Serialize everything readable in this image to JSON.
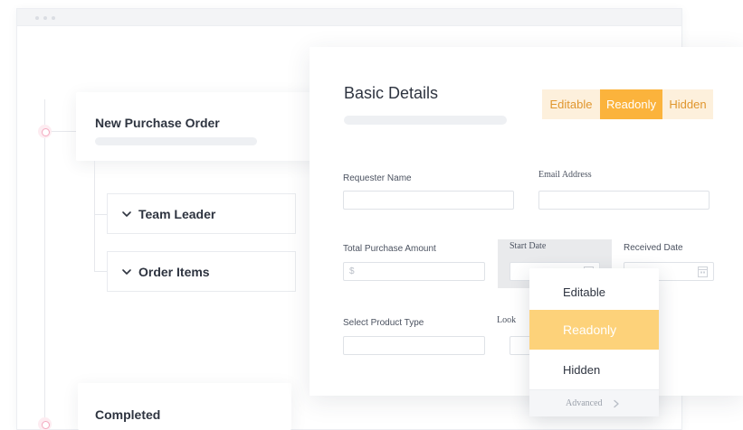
{
  "workflow": {
    "steps": [
      {
        "title": "New Purchase Order"
      },
      {
        "title": "Completed"
      }
    ],
    "substeps": [
      {
        "label": "Team Leader",
        "icon": "chevron-down-icon"
      },
      {
        "label": "Order Items",
        "icon": "chevron-down-icon"
      }
    ]
  },
  "form": {
    "title": "Basic Details",
    "permission_toggle": {
      "options": [
        "Editable",
        "Readonly",
        "Hidden"
      ],
      "selected": "Readonly"
    },
    "fields": {
      "requester_name": {
        "label": "Requester Name",
        "value": ""
      },
      "email_address": {
        "label": "Email Address",
        "value": ""
      },
      "total_purchase_amount": {
        "label": "Total Purchase Amount",
        "prefix": "$",
        "value": ""
      },
      "start_date": {
        "label": "Start Date",
        "value": "",
        "icon": "calendar-icon"
      },
      "received_date": {
        "label": "Received Date",
        "value": "",
        "icon": "calendar-icon"
      },
      "select_product_type": {
        "label": "Select Product Type",
        "value": ""
      },
      "lookup": {
        "label": "Look",
        "value": ""
      }
    }
  },
  "dropdown": {
    "items": [
      "Editable",
      "Readonly",
      "Hidden"
    ],
    "highlighted": "Readonly",
    "footer_label": "Advanced",
    "footer_icon": "chevron-right-icon"
  },
  "colors": {
    "accent": "#fbb33c",
    "accent_light": "#fdf0dc",
    "accent_text": "#e0962e",
    "dropdown_highlight": "#fdd27a",
    "timeline_node": "#f4a9bf"
  }
}
